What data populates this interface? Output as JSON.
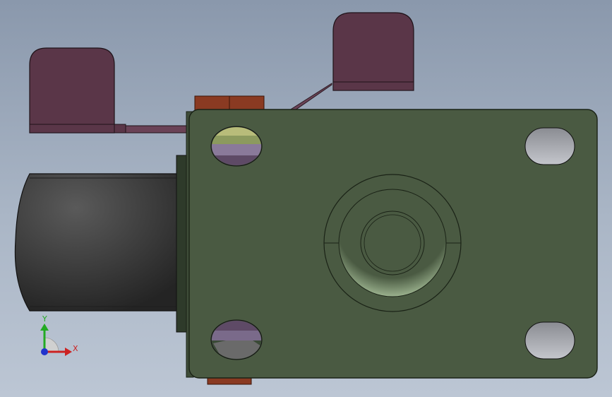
{
  "viewport": {
    "background_top": "#8a98ac",
    "background_bottom": "#bcc6d4"
  },
  "model": {
    "components": [
      "caster-wheel",
      "top-plate",
      "brake-pedal-left",
      "brake-pedal-right",
      "hex-nut",
      "swivel-bearing"
    ],
    "colors": {
      "plate": "#4a5a42",
      "plate_edge": "#2e3a2a",
      "wheel": "#3a3a3a",
      "pedal": "#5a3648",
      "nut": "#8a3a22",
      "bearing_ring": "#7f9a72"
    }
  },
  "triad": {
    "x_label": "X",
    "y_label": "Y",
    "x_color": "#cc2222",
    "y_color": "#22aa22",
    "z_color": "#2233cc"
  }
}
